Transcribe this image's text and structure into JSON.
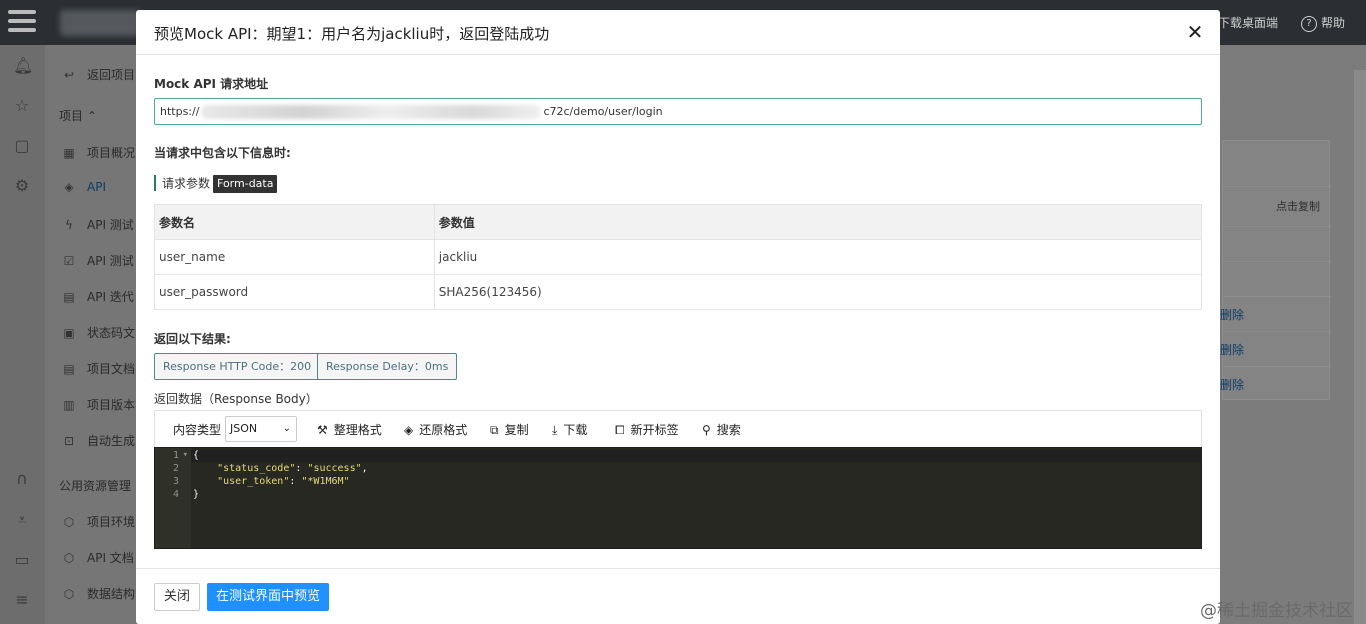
{
  "background": {
    "topbar": {
      "desktop_label": "下载桌面端",
      "help_label": "帮助"
    },
    "sidebar": {
      "back_label": "返回项目",
      "project_group": "项目 ⌃",
      "items": [
        {
          "label": "项目概况",
          "icon": "overview-icon"
        },
        {
          "label": "API",
          "icon": "api-icon"
        },
        {
          "label": "API 测试",
          "icon": "bolt-icon"
        },
        {
          "label": "API 测试",
          "icon": "checklist-icon"
        },
        {
          "label": "API 迭代",
          "icon": "calendar-icon"
        },
        {
          "label": "状态码文",
          "icon": "doc-icon"
        },
        {
          "label": "项目文档",
          "icon": "doc2-icon"
        },
        {
          "label": "项目版本",
          "icon": "version-icon"
        },
        {
          "label": "自动生成",
          "icon": "robot-icon"
        }
      ],
      "public_group": "公用资源管理 ⌃",
      "public_items": [
        {
          "label": "项目环境",
          "icon": "cube-icon"
        },
        {
          "label": "API 文档",
          "icon": "cube2-icon"
        },
        {
          "label": "数据结构",
          "icon": "cube3-icon"
        }
      ]
    },
    "panel": {
      "copy_label": "点击复制",
      "delete_labels": [
        "删除",
        "删除",
        "删除"
      ]
    },
    "watermark": "@稀土掘金技术社区"
  },
  "modal": {
    "title": "预览Mock API：期望1：用户名为jackliu时，返回登陆成功",
    "close_glyph": "✕",
    "url_label": "Mock API 请求地址",
    "url_prefix": "https://",
    "url_suffix": "c72c/demo/user/login",
    "request_info_label": "当请求中包含以下信息时:",
    "params_title": "请求参数",
    "params_badge": "Form-data",
    "params_table": {
      "headers": [
        "参数名",
        "参数值"
      ],
      "rows": [
        [
          "user_name",
          "jackliu"
        ],
        [
          "user_password",
          "SHA256(123456)"
        ]
      ]
    },
    "return_label": "返回以下结果:",
    "http_code_label": "Response HTTP Code：200",
    "delay_label": "Response Delay：0ms",
    "response_body_label": "返回数据（Response Body）",
    "toolbar": {
      "content_type_label": "内容类型",
      "content_type_value": "JSON",
      "format_label": "整理格式",
      "restore_label": "还原格式",
      "copy_label": "复制",
      "download_label": "下载",
      "new_tab_label": "新开标签",
      "search_label": "搜索"
    },
    "code": {
      "line_numbers": [
        "1",
        "2",
        "3",
        "4"
      ],
      "line1": "{",
      "key1": "\"status_code\"",
      "val1": "\"success\"",
      "key2": "\"user_token\"",
      "val2": "\"*W1M6M\"",
      "line4": "}"
    },
    "footer": {
      "close_label": "关闭",
      "preview_label": "在测试界面中预览"
    }
  }
}
